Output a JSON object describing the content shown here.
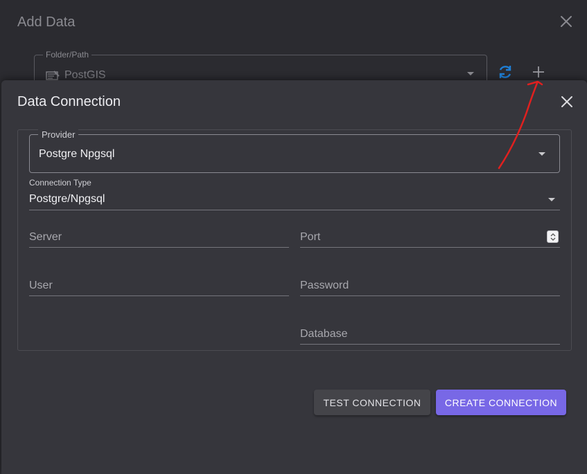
{
  "background_dialog": {
    "title": "Add Data",
    "folder_path_label": "Folder/Path",
    "folder_path_value": "PostGIS",
    "icons": [
      "folder-icon",
      "refresh-icon",
      "add-icon",
      "close-icon"
    ],
    "refresh_color": "#1f7fd6"
  },
  "dialog": {
    "title": "Data Connection",
    "provider": {
      "label": "Provider",
      "value": "Postgre Npgsql"
    },
    "connection_type": {
      "label": "Connection Type",
      "value": "Postgre/Npgsql"
    },
    "fields": {
      "server": {
        "placeholder": "Server"
      },
      "port": {
        "placeholder": "Port"
      },
      "user": {
        "placeholder": "User"
      },
      "password": {
        "placeholder": "Password"
      },
      "database": {
        "placeholder": "Database"
      }
    },
    "buttons": {
      "test": "TEST CONNECTION",
      "create": "CREATE CONNECTION"
    }
  },
  "colors": {
    "accent": "#7868e6",
    "annotation": "#e0201f"
  }
}
